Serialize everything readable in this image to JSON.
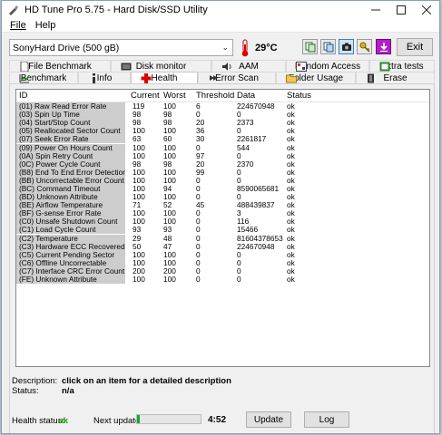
{
  "window": {
    "title": "HD Tune Pro 5.75 - Hard Disk/SSD Utility"
  },
  "menu": {
    "file": "File",
    "help": "Help"
  },
  "toolbar": {
    "drive": "SonyHard Drive (500 gB)",
    "temperature": "29°C",
    "exit_label": "Exit"
  },
  "tabs_row1": [
    "File Benchmark",
    "Disk monitor",
    "AAM",
    "Random Access",
    "Extra tests"
  ],
  "tabs_row2": [
    "Benchmark",
    "Info",
    "Health",
    "Error Scan",
    "Folder Usage",
    "Erase"
  ],
  "active_tab": "Health",
  "table": {
    "headers": [
      "ID",
      "Current",
      "Worst",
      "Threshold",
      "Data",
      "Status"
    ],
    "rows": [
      [
        "(01) Raw Read Error Rate",
        "119",
        "100",
        "6",
        "224670948",
        "ok"
      ],
      [
        "(03) Spin Up Time",
        "98",
        "98",
        "0",
        "0",
        "ok"
      ],
      [
        "(04) Start/Stop Count",
        "98",
        "98",
        "20",
        "2373",
        "ok"
      ],
      [
        "(05) Reallocated Sector Count",
        "100",
        "100",
        "36",
        "0",
        "ok"
      ],
      [
        "(07) Seek Error Rate",
        "63",
        "60",
        "30",
        "2261817",
        "ok"
      ],
      [
        "(09) Power On Hours Count",
        "100",
        "100",
        "0",
        "544",
        "ok"
      ],
      [
        "(0A) Spin Retry Count",
        "100",
        "100",
        "97",
        "0",
        "ok"
      ],
      [
        "(0C) Power Cycle Count",
        "98",
        "98",
        "20",
        "2370",
        "ok"
      ],
      [
        "(B8) End To End Error Detection",
        "100",
        "100",
        "99",
        "0",
        "ok"
      ],
      [
        "(BB) Uncorrectable Error Count",
        "100",
        "100",
        "0",
        "0",
        "ok"
      ],
      [
        "(BC) Command Timeout",
        "100",
        "94",
        "0",
        "8590065681",
        "ok"
      ],
      [
        "(BD) Unknown Attribute",
        "100",
        "100",
        "0",
        "0",
        "ok"
      ],
      [
        "(BE) Airflow Temperature",
        "71",
        "52",
        "45",
        "488439837",
        "ok"
      ],
      [
        "(BF) G-sense Error Rate",
        "100",
        "100",
        "0",
        "3",
        "ok"
      ],
      [
        "(C0) Unsafe Shutdown Count",
        "100",
        "100",
        "0",
        "116",
        "ok"
      ],
      [
        "(C1) Load Cycle Count",
        "93",
        "93",
        "0",
        "15466",
        "ok"
      ],
      [
        "(C2) Temperature",
        "29",
        "48",
        "0",
        "81604378653",
        "ok"
      ],
      [
        "(C3) Hardware ECC Recovered",
        "50",
        "47",
        "0",
        "224670948",
        "ok"
      ],
      [
        "(C5) Current Pending Sector",
        "100",
        "100",
        "0",
        "0",
        "ok"
      ],
      [
        "(C6) Offline Uncorrectable",
        "100",
        "100",
        "0",
        "0",
        "ok"
      ],
      [
        "(C7) Interface CRC Error Count",
        "200",
        "200",
        "0",
        "0",
        "ok"
      ],
      [
        "(FE) Unknown Attribute",
        "100",
        "100",
        "0",
        "0",
        "ok"
      ]
    ]
  },
  "description": {
    "label": "Description:",
    "value": "click on an item for a detailed description"
  },
  "status": {
    "label": "Status:",
    "value": "n/a"
  },
  "footer": {
    "health_label": "Health status:",
    "health_value": "ok",
    "next_update_label": "Next update:",
    "next_update_progress": 0.04,
    "time": "4:52",
    "update_label": "Update",
    "log_label": "Log"
  },
  "colors": {
    "ok_green": "#1a9e1a",
    "progress_green": "#06b025",
    "id_column_bg": "#cdcdcd"
  }
}
